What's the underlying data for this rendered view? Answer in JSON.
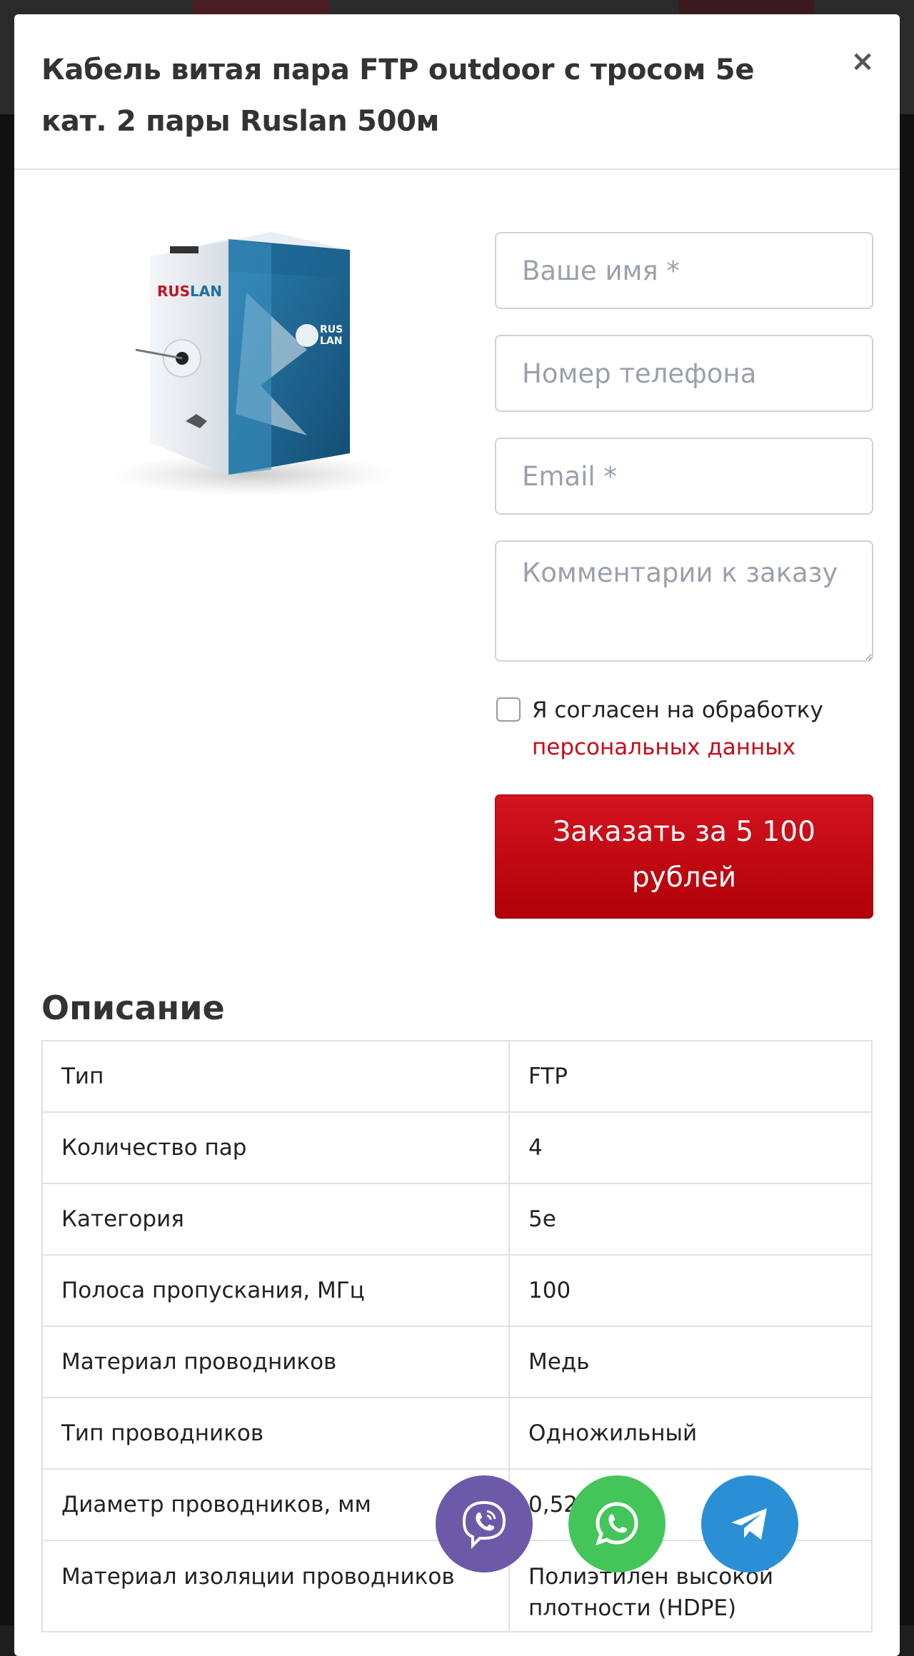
{
  "modal": {
    "title": "Кабель витая пара FTP outdoor с тросом 5е кат. 2 пары Ruslan 500м",
    "close_label": "×"
  },
  "product_image": {
    "icon": "cable-box-image",
    "brand_text": "RUS LAN",
    "accent_color": "#1e6f9e"
  },
  "form": {
    "name_placeholder": "Ваше имя *",
    "phone_placeholder": "Номер телефона",
    "email_placeholder": "Email *",
    "comment_placeholder": "Комментарии к заказу",
    "consent_text": "Я согласен на обработку ",
    "consent_link": "персональных данных",
    "order_button": "Заказать за 5 100 рублей"
  },
  "description": {
    "title": "Описание",
    "rows": [
      {
        "key": "Тип",
        "value": "FTP"
      },
      {
        "key": "Количество пар",
        "value": "4"
      },
      {
        "key": "Категория",
        "value": "5e"
      },
      {
        "key": "Полоса пропускания, МГц",
        "value": "100"
      },
      {
        "key": "Материал проводников",
        "value": "Медь"
      },
      {
        "key": "Тип проводников",
        "value": "Одножильный"
      },
      {
        "key": "Диаметр проводников, мм",
        "value": "0,52"
      },
      {
        "key": "Материал изоляции проводников",
        "value": "Полиэтилен высокой плотности (HDPE)"
      }
    ]
  },
  "messengers": [
    {
      "name": "Viber",
      "icon": "viber-icon",
      "color": "#6c5aa9"
    },
    {
      "name": "WhatsApp",
      "icon": "whatsapp-icon",
      "color": "#44c55a"
    },
    {
      "name": "Telegram",
      "icon": "telegram-icon",
      "color": "#2b8fd6"
    }
  ]
}
